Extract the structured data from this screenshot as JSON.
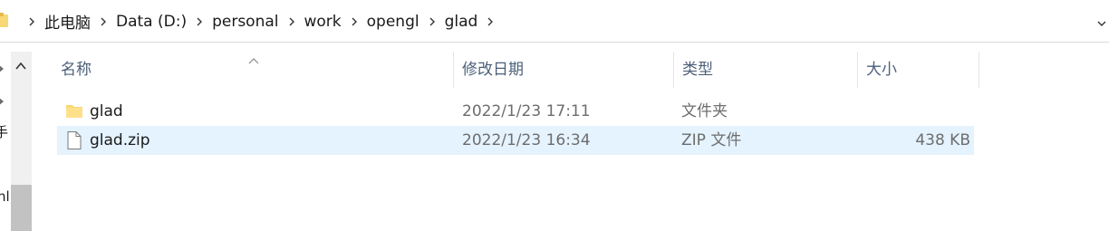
{
  "address_bar": {
    "crumbs": [
      "此电脑",
      "Data (D:)",
      "personal",
      "work",
      "opengl",
      "glad"
    ],
    "icons": {
      "folder": "folder-icon",
      "separator": "chevron-right-icon",
      "dropdown": "chevron-down-icon"
    }
  },
  "nav_pane": {
    "partial_labels": [
      "手",
      "nl"
    ],
    "icons": {
      "expander": "chevron-right-icon",
      "scroll_up": "chevron-up-icon"
    }
  },
  "columns": {
    "name": "名称",
    "date": "修改日期",
    "type": "类型",
    "size": "大小",
    "sort_indicator": "sort-ascending-icon"
  },
  "files": [
    {
      "name": "glad",
      "date": "2022/1/23 17:11",
      "type": "文件夹",
      "size": "",
      "icon": "folder-icon",
      "selected": false
    },
    {
      "name": "glad.zip",
      "date": "2022/1/23 16:34",
      "type": "ZIP 文件",
      "size": "438 KB",
      "icon": "file-icon",
      "selected": true
    }
  ],
  "colors": {
    "selection": "#e5f3ff",
    "folder": "#f8d775",
    "header_text": "#4c607a"
  }
}
